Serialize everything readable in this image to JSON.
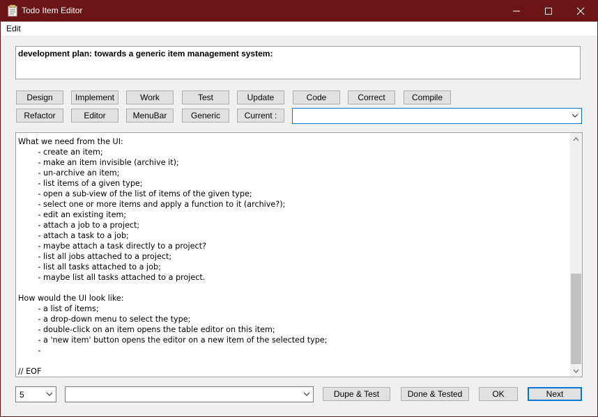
{
  "window": {
    "title": "Todo Item Editor",
    "colors": {
      "titlebar": "#6b1416",
      "accent": "#0078d7"
    }
  },
  "menu": {
    "edit": "Edit"
  },
  "header_text": "development plan: towards a generic item management system:",
  "buttons_row1": [
    "Design",
    "Implement",
    "Work",
    "Test",
    "Update",
    "Code",
    "Correct",
    "Compile"
  ],
  "buttons_row2": [
    "Refactor",
    "Editor",
    "MenuBar",
    "Generic",
    "Current :"
  ],
  "current_combo": {
    "value": ""
  },
  "body_text": "What we need from the UI:\n\t- create an item;\n\t- make an item invisible (archive it);\n\t- un-archive an item;\n\t- list items of a given type;\n\t- open a sub-view of the list of items of the given type;\n\t- select one or more items and apply a function to it (archive?);\n\t- edit an existing item;\n\t- attach a job to a project;\n\t- attach a task to a job;\n\t- maybe attach a task directly to a project?\n\t- list all jobs attached to a project;\n\t- list all tasks attached to a job;\n\t- maybe list all tasks attached to a project.\n\nHow would the UI look like:\n\t- a list of items;\n\t- a drop-down menu to select the type;\n\t- double-click on an item opens the table editor on this item;\n\t- a 'new item' button opens the editor on a new item of the selected type;\n\t-\n\n// EOF",
  "footer": {
    "priority_value": "5",
    "secondary_combo_value": "",
    "dupe_test": "Dupe & Test",
    "done_tested": "Done & Tested",
    "ok": "OK",
    "next": "Next"
  }
}
